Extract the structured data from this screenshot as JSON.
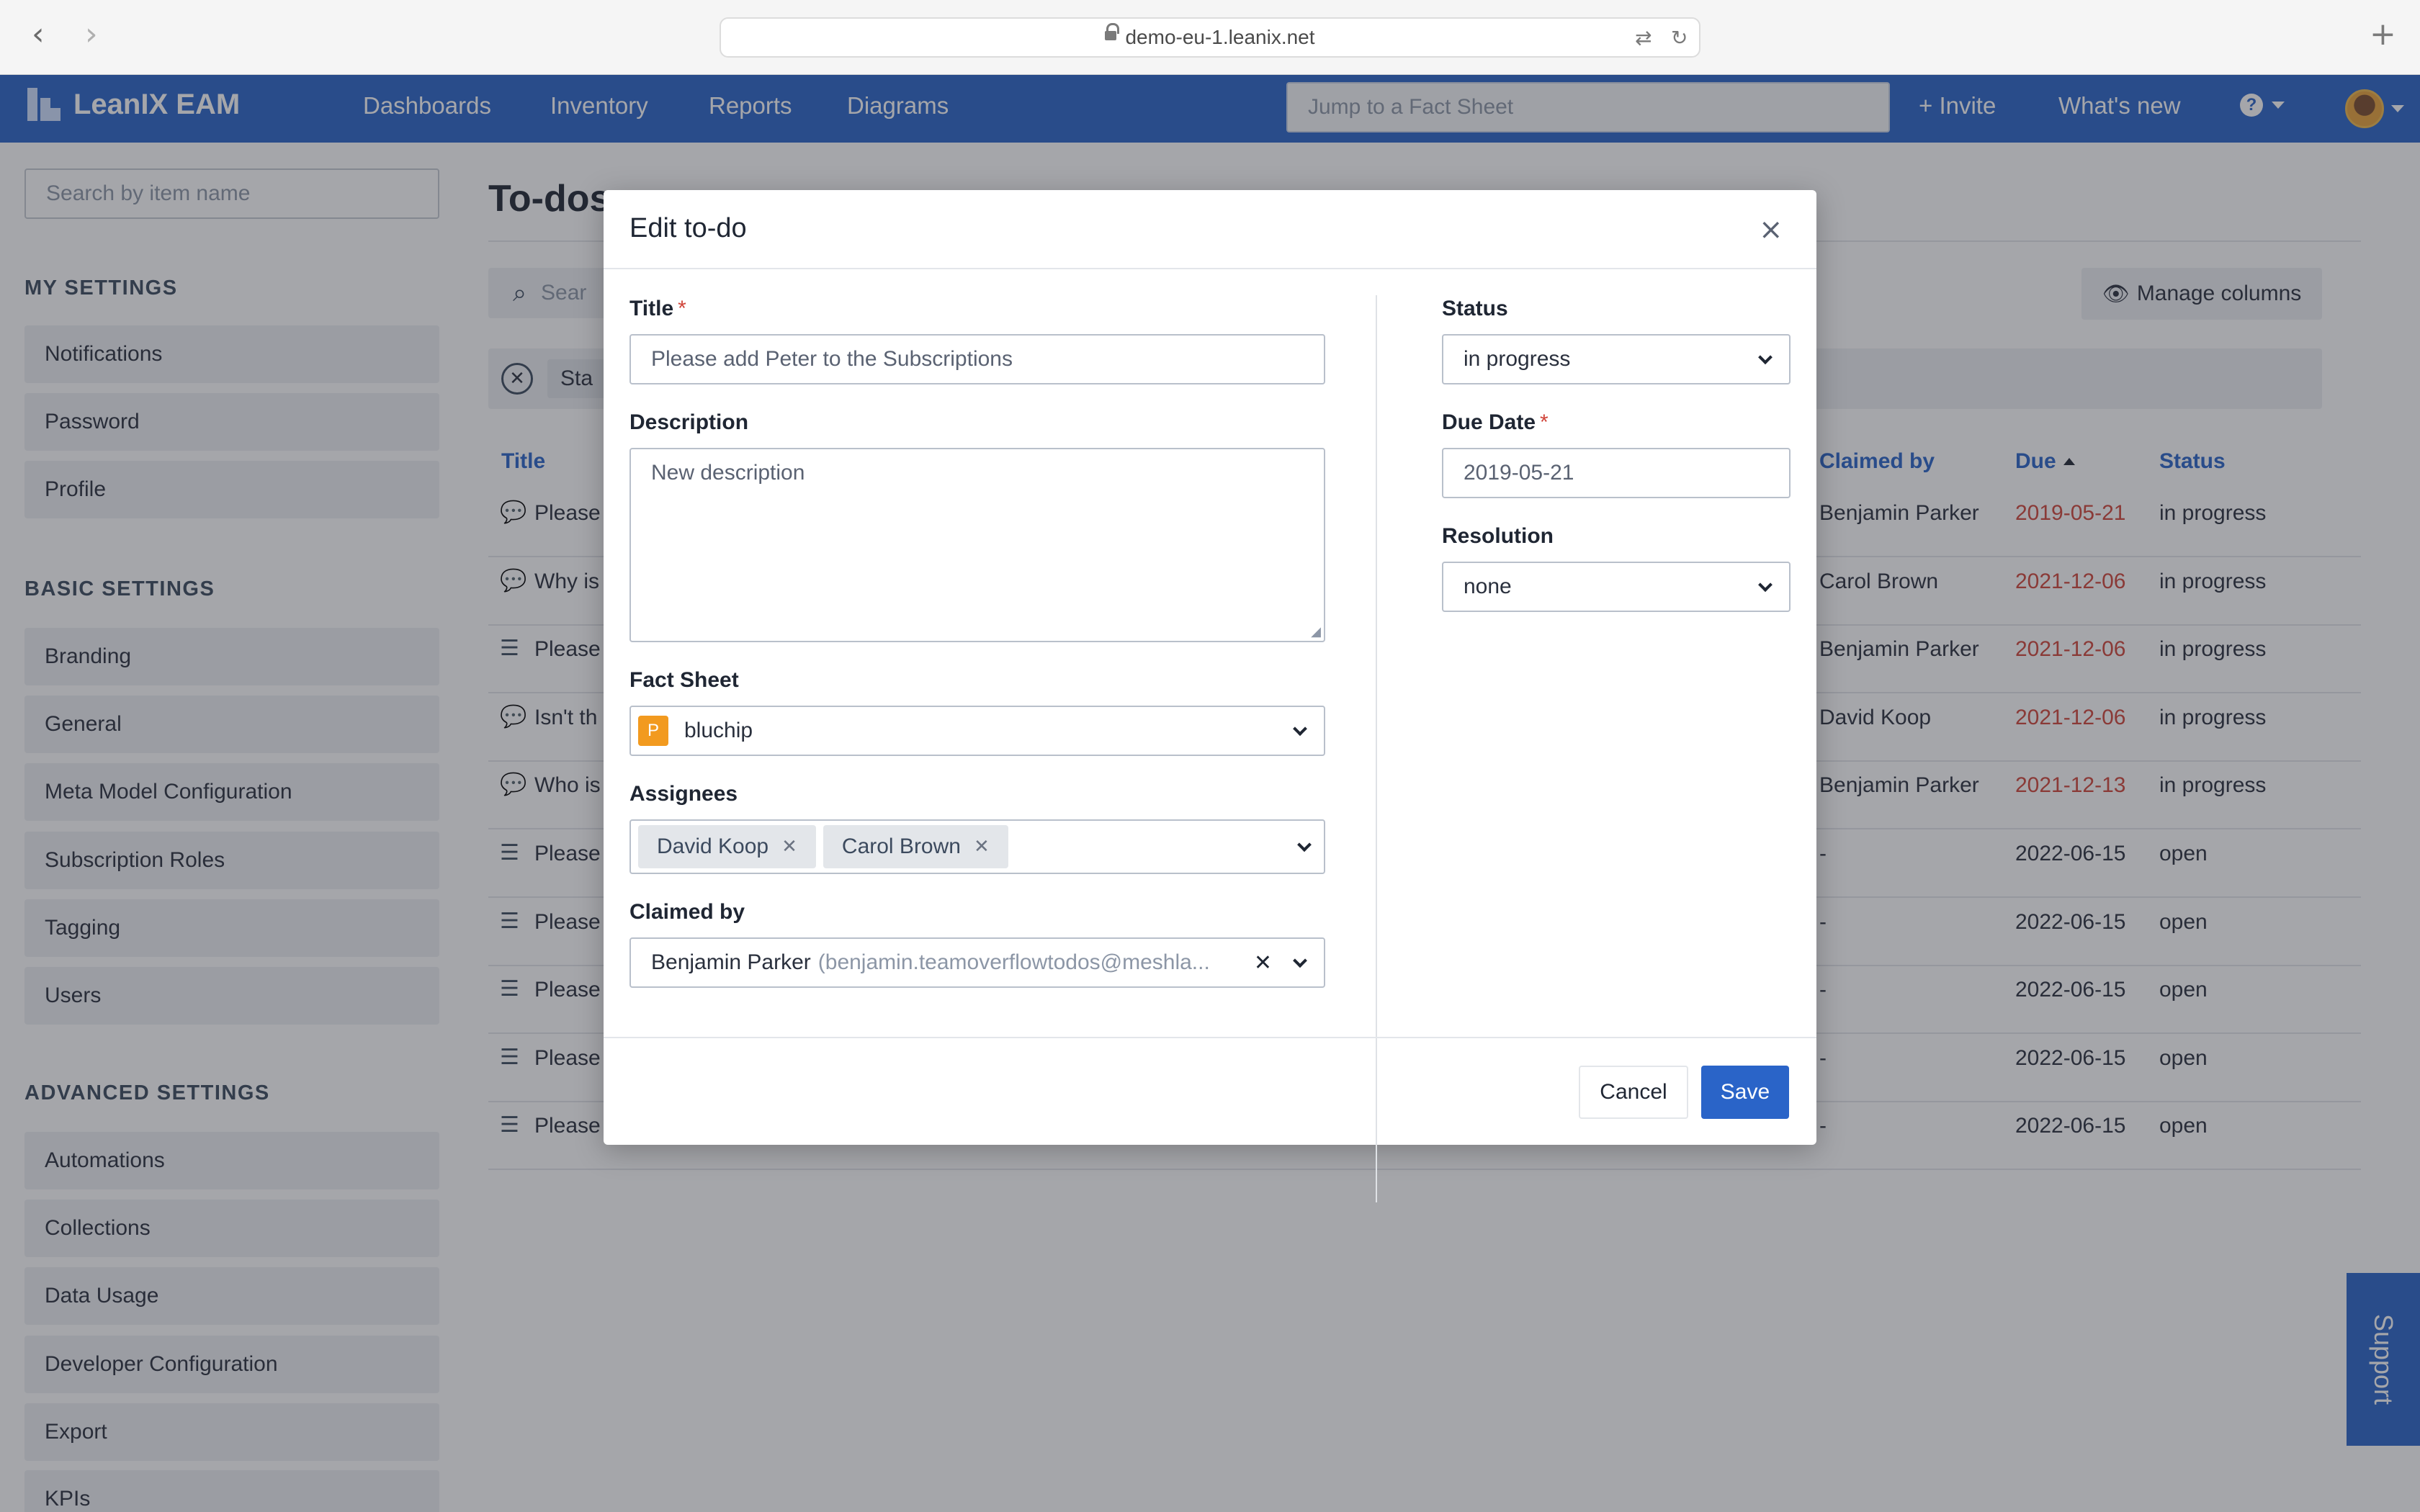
{
  "browser": {
    "url": "demo-eu-1.leanix.net",
    "back": "‹",
    "forward": "›",
    "new_tab": "+"
  },
  "header": {
    "logo": "LeanIX EAM",
    "nav": [
      "Dashboards",
      "Inventory",
      "Reports",
      "Diagrams"
    ],
    "search_placeholder": "Jump to a Fact Sheet",
    "invite": "+ Invite",
    "whats_new": "What's new",
    "help": "?"
  },
  "sidebar": {
    "search_placeholder": "Search by item name",
    "sections": [
      {
        "heading": "MY SETTINGS",
        "items": [
          "Notifications",
          "Password",
          "Profile"
        ]
      },
      {
        "heading": "BASIC SETTINGS",
        "items": [
          "Branding",
          "General",
          "Meta Model Configuration",
          "Subscription Roles",
          "Tagging",
          "Users"
        ]
      },
      {
        "heading": "ADVANCED SETTINGS",
        "items": [
          "Automations",
          "Collections",
          "Data Usage",
          "Developer Configuration",
          "Export",
          "KPIs"
        ]
      }
    ]
  },
  "main": {
    "title": "To-dos",
    "search_partial": "Sear",
    "filter_partial": "Sta",
    "manage_columns": "Manage columns",
    "columns": {
      "title": "Title",
      "claimed_by": "Claimed by",
      "due": "Due",
      "status": "Status"
    },
    "rows": [
      {
        "icon": "comment",
        "title": "Please",
        "claimed": "Benjamin Parker",
        "due": "2019-05-21",
        "overdue": true,
        "status": "in progress"
      },
      {
        "icon": "comment",
        "title": "Why is",
        "claimed": "Carol Brown",
        "due": "2021-12-06",
        "overdue": true,
        "status": "in progress"
      },
      {
        "icon": "list",
        "title": "Please",
        "claimed": "Benjamin Parker",
        "due": "2021-12-06",
        "overdue": true,
        "status": "in progress"
      },
      {
        "icon": "comment",
        "title": "Isn't th",
        "claimed": "David Koop",
        "due": "2021-12-06",
        "overdue": true,
        "status": "in progress"
      },
      {
        "icon": "comment",
        "title": "Who is",
        "claimed": "Benjamin Parker",
        "due": "2021-12-13",
        "overdue": true,
        "status": "in progress"
      },
      {
        "icon": "list",
        "title": "Please",
        "claimed": "-",
        "due": "2022-06-15",
        "overdue": false,
        "status": "open"
      },
      {
        "icon": "list",
        "title": "Please",
        "claimed": "-",
        "due": "2022-06-15",
        "overdue": false,
        "status": "open"
      },
      {
        "icon": "list",
        "title": "Please",
        "claimed": "-",
        "due": "2022-06-15",
        "overdue": false,
        "status": "open"
      },
      {
        "icon": "list",
        "title": "Please",
        "claimed": "-",
        "due": "2022-06-15",
        "overdue": false,
        "status": "open"
      },
      {
        "icon": "list",
        "title": "Please",
        "claimed": "-",
        "due": "2022-06-15",
        "overdue": false,
        "status": "open"
      }
    ]
  },
  "support": "Support",
  "modal": {
    "title": "Edit to-do",
    "close": "×",
    "title_label": "Title",
    "title_value": "Please add Peter to the Subscriptions",
    "description_label": "Description",
    "description_value": "New description",
    "fact_sheet_label": "Fact Sheet",
    "fact_sheet_badge": "P",
    "fact_sheet_value": "bluchip",
    "assignees_label": "Assignees",
    "assignees": [
      "David Koop",
      "Carol Brown"
    ],
    "claimed_by_label": "Claimed by",
    "claimed_by_name": "Benjamin Parker",
    "claimed_by_email": "(benjamin.teamoverflowtodos@meshla...",
    "status_label": "Status",
    "status_value": "in progress",
    "due_date_label": "Due Date",
    "due_date_value": "2019-05-21",
    "resolution_label": "Resolution",
    "resolution_value": "none",
    "required_mark": "*",
    "cancel": "Cancel",
    "save": "Save"
  },
  "colors": {
    "brand": "#2a64c8",
    "overdue": "#d0453a",
    "fact_sheet_badge": "#f29a1f"
  }
}
